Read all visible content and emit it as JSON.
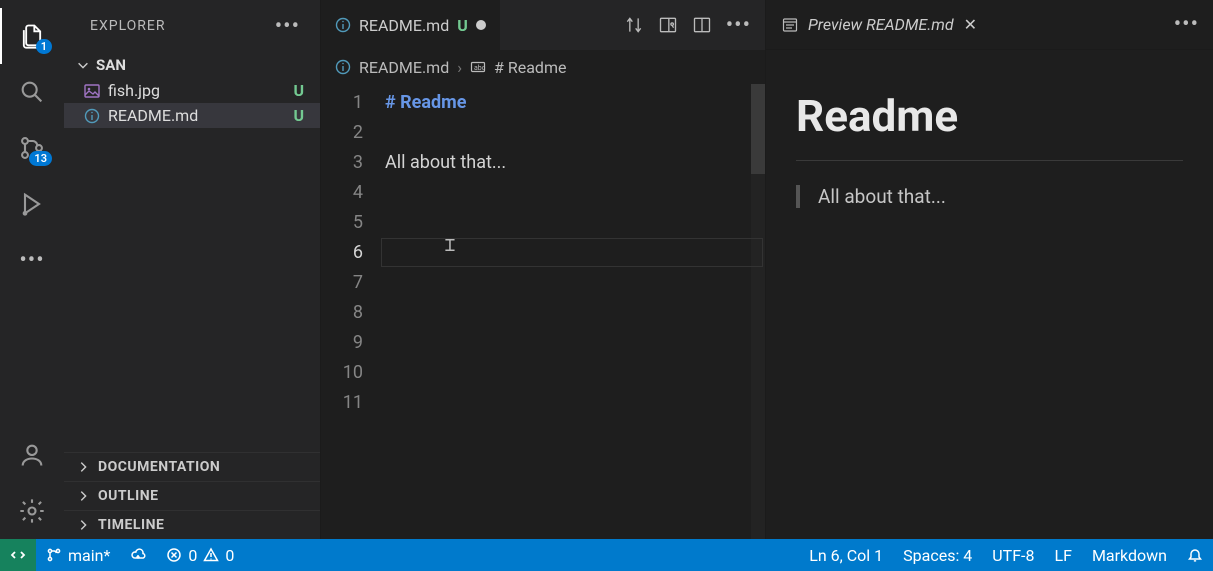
{
  "activityBar": {
    "explorerBadge": "1",
    "scmBadge": "13"
  },
  "sidebar": {
    "title": "EXPLORER",
    "folder": "SAN",
    "files": [
      {
        "name": "fish.jpg",
        "status": "U",
        "icon": "image-icon"
      },
      {
        "name": "README.md",
        "status": "U",
        "icon": "info-icon"
      }
    ],
    "sections": [
      {
        "label": "DOCUMENTATION"
      },
      {
        "label": "OUTLINE"
      },
      {
        "label": "TIMELINE"
      }
    ]
  },
  "editor": {
    "tabLabel": "README.md",
    "tabStatus": "U",
    "breadcrumb": {
      "file": "README.md",
      "symbol": "# Readme"
    },
    "lines": {
      "l1_hash": "# ",
      "l1_txt": "Readme",
      "l3": "All about that..."
    },
    "lineNumbers": [
      "1",
      "2",
      "3",
      "4",
      "5",
      "6",
      "7",
      "8",
      "9",
      "10",
      "11"
    ],
    "currentLineIdx": 5
  },
  "preview": {
    "tabLabel": "Preview README.md",
    "h1": "Readme",
    "p": "All about that..."
  },
  "status": {
    "branch": "main*",
    "errors": "0",
    "warnings": "0",
    "cursor": "Ln 6, Col 1",
    "spaces": "Spaces: 4",
    "encoding": "UTF-8",
    "eol": "LF",
    "lang": "Markdown"
  }
}
